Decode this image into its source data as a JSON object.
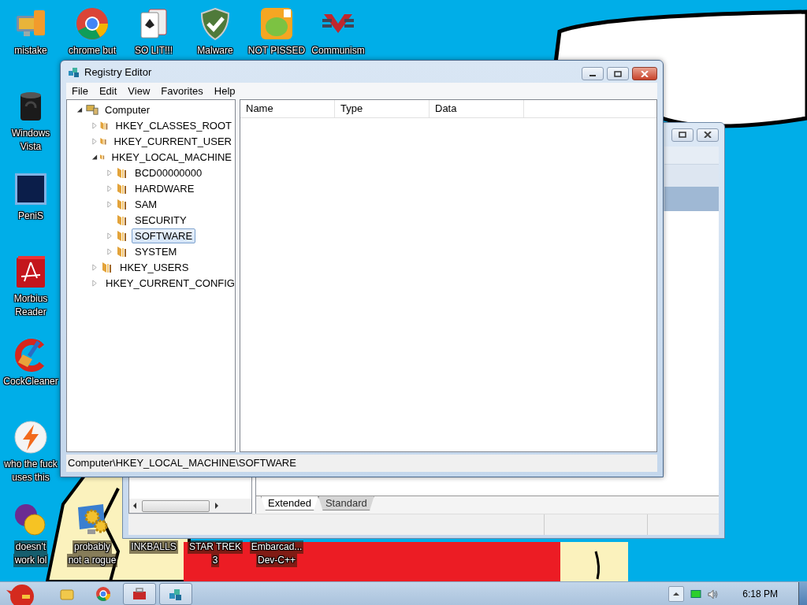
{
  "desktop_icons": [
    {
      "kind": "computer",
      "lines": [
        "mistake"
      ]
    },
    {
      "kind": "browser",
      "lines": [
        "chrome but"
      ]
    },
    {
      "kind": "cards",
      "lines": [
        "SO LIT!!!"
      ]
    },
    {
      "kind": "shield",
      "lines": [
        "Malware"
      ]
    },
    {
      "kind": "game",
      "lines": [
        "NOT PISSED"
      ]
    },
    {
      "kind": "emblem",
      "lines": [
        "Communism"
      ]
    },
    {
      "kind": "cylinder",
      "lines": [
        "Windows",
        "Vista"
      ]
    },
    {
      "kind": "tile",
      "lines": [
        "PeniS"
      ]
    },
    {
      "kind": "book",
      "lines": [
        "Morbius",
        "Reader"
      ]
    },
    {
      "kind": "brush",
      "lines": [
        "CockCleaner"
      ]
    },
    {
      "kind": "bolt",
      "lines": [
        "who the fuck",
        "uses this"
      ]
    },
    {
      "kind": "chat",
      "lines": [
        "doesn't",
        "work lol"
      ]
    },
    {
      "kind": "gears",
      "lines": [
        "probably",
        "not a rogue"
      ]
    },
    {
      "lines": [
        "INKBALLS"
      ]
    },
    {
      "lines": [
        "STAR TREK",
        "3"
      ]
    },
    {
      "lines": [
        "Embarcad...",
        "Dev-C++"
      ]
    }
  ],
  "registry_window": {
    "title": "Registry Editor",
    "menu": [
      "File",
      "Edit",
      "View",
      "Favorites",
      "Help"
    ],
    "tree": [
      {
        "label": "Computer",
        "kind": "computer",
        "expandable": true,
        "expanded": true,
        "selected": false,
        "children": [
          {
            "label": "HKEY_CLASSES_ROOT",
            "expandable": true,
            "expanded": false,
            "selected": false
          },
          {
            "label": "HKEY_CURRENT_USER",
            "expandable": true,
            "expanded": false,
            "selected": false
          },
          {
            "label": "HKEY_LOCAL_MACHINE",
            "expandable": true,
            "expanded": true,
            "selected": false,
            "children": [
              {
                "label": "BCD00000000",
                "expandable": true,
                "expanded": false,
                "selected": false
              },
              {
                "label": "HARDWARE",
                "expandable": true,
                "expanded": false,
                "selected": false
              },
              {
                "label": "SAM",
                "expandable": true,
                "expanded": false,
                "selected": false
              },
              {
                "label": "SECURITY",
                "expandable": false,
                "expanded": false,
                "selected": false
              },
              {
                "label": "SOFTWARE",
                "expandable": true,
                "expanded": false,
                "selected": true
              },
              {
                "label": "SYSTEM",
                "expandable": true,
                "expanded": false,
                "selected": false
              }
            ]
          },
          {
            "label": "HKEY_USERS",
            "expandable": true,
            "expanded": false,
            "selected": false
          },
          {
            "label": "HKEY_CURRENT_CONFIG",
            "expandable": true,
            "expanded": false,
            "selected": false
          }
        ]
      }
    ],
    "columns": [
      "Name",
      "Type",
      "Data"
    ],
    "status": "Computer\\HKEY_LOCAL_MACHINE\\SOFTWARE"
  },
  "back_window": {
    "tabs": [
      {
        "label": "Extended",
        "selected": true
      },
      {
        "label": "Standard",
        "selected": false
      }
    ]
  },
  "taskbar": {
    "items": [
      {
        "kind": "folder",
        "running": false
      },
      {
        "kind": "browser",
        "running": false
      },
      {
        "kind": "toolbox",
        "running": true
      },
      {
        "kind": "registry",
        "running": true
      }
    ],
    "clock": "6:18 PM"
  }
}
